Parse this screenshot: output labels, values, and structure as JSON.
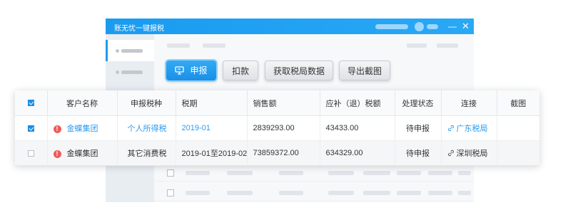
{
  "window": {
    "title": "账无忧一键报税"
  },
  "toolbar": {
    "buttons": [
      {
        "label": "申报",
        "icon": "monitor-icon",
        "primary": true
      },
      {
        "label": "扣款"
      },
      {
        "label": "获取税局数据"
      },
      {
        "label": "导出截图"
      }
    ]
  },
  "table": {
    "headers": [
      "客户名称",
      "申报税种",
      "税期",
      "销售额",
      "应补（退）税额",
      "处理状态",
      "连接",
      "截图"
    ],
    "rows": [
      {
        "checked": true,
        "customer": "金蝶集团",
        "tax_type": "个人所得税",
        "period": "2019-01",
        "sales": "2839293.00",
        "tax": "43433.00",
        "status": "待申报",
        "link": "广东税局",
        "warn_icon": "exclamation-icon"
      },
      {
        "checked": false,
        "customer": "金蝶集团",
        "tax_type": "其它消费税",
        "period": "2019-01至2019-02",
        "sales": "73859372.00",
        "tax": "634329.00",
        "status": "待申报",
        "link": "深圳税局",
        "warn_icon": "exclamation-icon"
      }
    ]
  },
  "colors": {
    "accent": "#1a9bf0",
    "warning": "#f05a5a"
  }
}
